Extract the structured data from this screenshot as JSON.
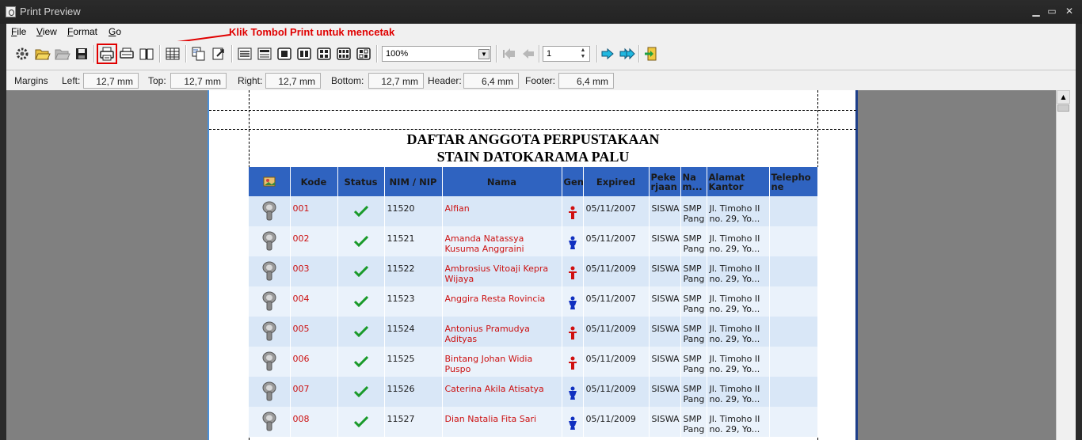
{
  "window": {
    "title": "Print Preview",
    "min_glyph": "▁",
    "max_glyph": "▭",
    "close_glyph": "✕"
  },
  "menu": [
    {
      "underlined": "F",
      "rest": "ile"
    },
    {
      "underlined": "V",
      "rest": "iew"
    },
    {
      "underlined": "F",
      "rest": "ormat"
    },
    {
      "underlined": "G",
      "rest": "o"
    }
  ],
  "annotation": "Klik Tombol Print untuk mencetak",
  "toolbar": {
    "zoom_value": "100%",
    "page_value": "1",
    "icons": [
      "settings-icon",
      "open-icon",
      "open-disabled-icon",
      "save-icon",
      "print-icon",
      "quick-print-icon",
      "page-setup-icon",
      "grid-icon",
      "copy-icon",
      "export-icon",
      "lines-icon",
      "page-icon",
      "one-page-icon",
      "two-pages-icon",
      "four-pages-icon",
      "six-pages-icon",
      "multi-pages-icon",
      "first-page-icon",
      "previous-page-icon",
      "next-page-icon",
      "last-page-icon",
      "exit-icon"
    ]
  },
  "margins": {
    "label": "Margins",
    "fields": [
      {
        "label": "Left:",
        "value": "12,7 mm"
      },
      {
        "label": "Top:",
        "value": "12,7 mm"
      },
      {
        "label": "Right:",
        "value": "12,7 mm"
      },
      {
        "label": "Bottom:",
        "value": "12,7 mm"
      },
      {
        "label": "Header:",
        "value": "6,4 mm"
      },
      {
        "label": "Footer:",
        "value": "6,4 mm"
      }
    ]
  },
  "report": {
    "title_line1": "DAFTAR ANGGOTA PERPUSTAKAAN",
    "title_line2": "STAIN DATOKARAMA PALU",
    "headers": [
      "",
      "Kode",
      "Status",
      "NIM / NIP",
      "Nama",
      "Gend",
      "Expired",
      "Peke rjaan",
      "Na m...",
      "Alamat Kantor",
      "Telepho ne"
    ],
    "rows": [
      {
        "kode": "001",
        "nim": "11520",
        "nama": "Alfian",
        "gender": "female",
        "expired": "05/11/2007",
        "pekerjaan": "SISWA",
        "nama_instansi": "SMP Pang",
        "alamat": "Jl. Timoho II no. 29, Yo...",
        "telephone": ""
      },
      {
        "kode": "002",
        "nim": "11521",
        "nama": "Amanda Natassya Kusuma Anggraini",
        "gender": "male",
        "expired": "05/11/2007",
        "pekerjaan": "SISWA",
        "nama_instansi": "SMP Pang",
        "alamat": "Jl. Timoho II no. 29, Yo...",
        "telephone": ""
      },
      {
        "kode": "003",
        "nim": "11522",
        "nama": "Ambrosius Vitoaji Kepra Wijaya",
        "gender": "female",
        "expired": "05/11/2009",
        "pekerjaan": "SISWA",
        "nama_instansi": "SMP Pang",
        "alamat": "Jl. Timoho II no. 29, Yo...",
        "telephone": ""
      },
      {
        "kode": "004",
        "nim": "11523",
        "nama": "Anggira Resta Rovincia",
        "gender": "male",
        "expired": "05/11/2007",
        "pekerjaan": "SISWA",
        "nama_instansi": "SMP Pang",
        "alamat": "Jl. Timoho II no. 29, Yo...",
        "telephone": ""
      },
      {
        "kode": "005",
        "nim": "11524",
        "nama": "Antonius Pramudya Adityas",
        "gender": "female",
        "expired": "05/11/2009",
        "pekerjaan": "SISWA",
        "nama_instansi": "SMP Pang",
        "alamat": "Jl. Timoho II no. 29, Yo...",
        "telephone": ""
      },
      {
        "kode": "006",
        "nim": "11525",
        "nama": "Bintang Johan Widia Puspo",
        "gender": "female",
        "expired": "05/11/2009",
        "pekerjaan": "SISWA",
        "nama_instansi": "SMP Pang",
        "alamat": "Jl. Timoho II no. 29, Yo...",
        "telephone": ""
      },
      {
        "kode": "007",
        "nim": "11526",
        "nama": "Caterina Akila Atisatya",
        "gender": "male",
        "expired": "05/11/2009",
        "pekerjaan": "SISWA",
        "nama_instansi": "SMP Pang",
        "alamat": "Jl. Timoho II no. 29, Yo...",
        "telephone": ""
      },
      {
        "kode": "008",
        "nim": "11527",
        "nama": "Dian Natalia Fita Sari",
        "gender": "male",
        "expired": "05/11/2009",
        "pekerjaan": "SISWA",
        "nama_instansi": "SMP Pang",
        "alamat": "Jl. Timoho II no. 29, Yo...",
        "telephone": ""
      }
    ]
  },
  "colors": {
    "header_bg": "#2f63c0",
    "row_odd": "#d9e7f7",
    "row_even": "#eaf2fb",
    "link_red": "#cc1111",
    "annotation_red": "#e00000"
  }
}
